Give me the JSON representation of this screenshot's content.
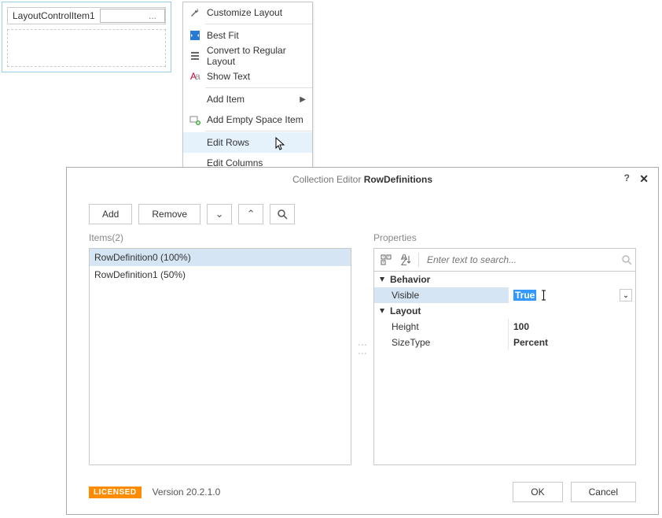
{
  "designer": {
    "label": "LayoutControlItem1",
    "ellipsis": "..."
  },
  "context_menu": {
    "items": [
      {
        "icon": "wrench-icon",
        "label": "Customize Layout"
      },
      {
        "icon": "bestfit-icon",
        "label": "Best Fit"
      },
      {
        "icon": "convert-icon",
        "label": "Convert to Regular Layout"
      },
      {
        "icon": "text-icon",
        "label": "Show Text"
      },
      {
        "icon": null,
        "label": "Add Item",
        "has_submenu": true
      },
      {
        "icon": "empty-item-icon",
        "label": "Add Empty Space Item"
      },
      {
        "icon": null,
        "label": "Edit Rows",
        "highlighted": true
      },
      {
        "icon": null,
        "label": "Edit Columns"
      }
    ]
  },
  "dialog": {
    "title_prefix": "Collection Editor ",
    "title_bold": "RowDefinitions",
    "help": "?",
    "close": "✕",
    "toolbar": {
      "add": "Add",
      "remove": "Remove",
      "move_down": "⌄",
      "move_up": "⌃",
      "search": "🔍"
    },
    "items_label": "Items(2)",
    "items": [
      {
        "label": "RowDefinition0 (100%)",
        "selected": true
      },
      {
        "label": "RowDefinition1 (50%)",
        "selected": false
      }
    ],
    "properties_label": "Properties",
    "prop_toolbar": {
      "categorized": "⊞",
      "alpha": "A↓",
      "search_placeholder": "Enter text to search...",
      "search_icon": "🔍"
    },
    "properties": [
      {
        "type": "category",
        "name": "Behavior"
      },
      {
        "type": "prop",
        "name": "Visible",
        "value": "True",
        "selected": true,
        "editing": true,
        "dropdown": true
      },
      {
        "type": "category",
        "name": "Layout"
      },
      {
        "type": "prop",
        "name": "Height",
        "value": "100"
      },
      {
        "type": "prop",
        "name": "SizeType",
        "value": "Percent"
      }
    ],
    "footer": {
      "licensed": "LICENSED",
      "version": "Version 20.2.1.0",
      "ok": "OK",
      "cancel": "Cancel"
    }
  }
}
